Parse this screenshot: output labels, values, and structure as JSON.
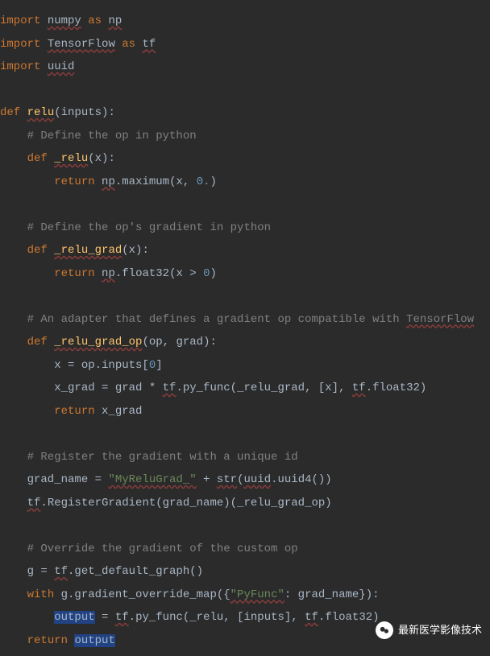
{
  "code": {
    "l1": {
      "kw1": "import",
      "mod": "numpy",
      "kw2": "as",
      "alias": "np"
    },
    "l2": {
      "kw1": "import",
      "mod": "TensorFlow",
      "kw2": "as",
      "alias": "tf"
    },
    "l3": {
      "kw1": "import",
      "mod": "uuid"
    },
    "l4": {
      "kw1": "def",
      "fn": "relu",
      "sig": "(inputs):"
    },
    "l5": "    # Define the op in python",
    "l6": {
      "kw1": "def",
      "fn": "_relu",
      "sig": "(x):"
    },
    "l7": {
      "kw1": "return",
      "mod": "np",
      "call": ".maximum(x",
      "comma": ", ",
      "num": "0.",
      "close": ")"
    },
    "l8": "    # Define the op's gradient in python",
    "l9": {
      "kw1": "def",
      "fn": "_relu_grad",
      "sig": "(x):"
    },
    "l10": {
      "kw1": "return",
      "mod": "np",
      "call": ".float32(x > ",
      "num": "0",
      "close": ")"
    },
    "l11": {
      "cmt1": "    # An adapter that defines a gradient op compatible with ",
      "cmt2": "TensorFlow"
    },
    "l12": {
      "kw1": "def",
      "fn": "_relu_grad_op",
      "sig": "(op, grad):"
    },
    "l13": {
      "pre": "        x = op.inputs[",
      "num": "0",
      "post": "]"
    },
    "l14": {
      "pre": "        x_grad = grad * ",
      "tf": "tf",
      "mid1": ".py_func(_relu_grad, [x], ",
      "tf2": "tf",
      "mid2": ".float32)"
    },
    "l15": {
      "kw1": "return",
      "var": "x_grad"
    },
    "l16": "    # Register the gradient with a unique id",
    "l17": {
      "pre": "    grad_name = ",
      "str": "\"MyReluGrad_\"",
      "mid": " + ",
      "strfn": "str",
      "post1": "(",
      "uuid": "uuid",
      "post2": ".uuid4())"
    },
    "l18": {
      "pre": "    ",
      "tf": "tf",
      "post": ".RegisterGradient(grad_name)(_relu_grad_op)"
    },
    "l19": "    # Override the gradient of the custom op",
    "l20": {
      "pre": "    g = ",
      "tf": "tf",
      "post": ".get_default_graph()"
    },
    "l21": {
      "kw1": "with",
      "mid1": " g.gradient_override_map({",
      "str": "\"PyFunc\"",
      "mid2": ": grad_name}):"
    },
    "l22": {
      "pre": "        ",
      "out": "output",
      "mid1": " = ",
      "tf": "tf",
      "mid2": ".py_func(_relu, [inputs], ",
      "tf2": "tf",
      "mid3": ".float32)"
    },
    "l23": {
      "kw1": "return",
      "out": "output"
    }
  },
  "watermark": "最新医学影像技术"
}
